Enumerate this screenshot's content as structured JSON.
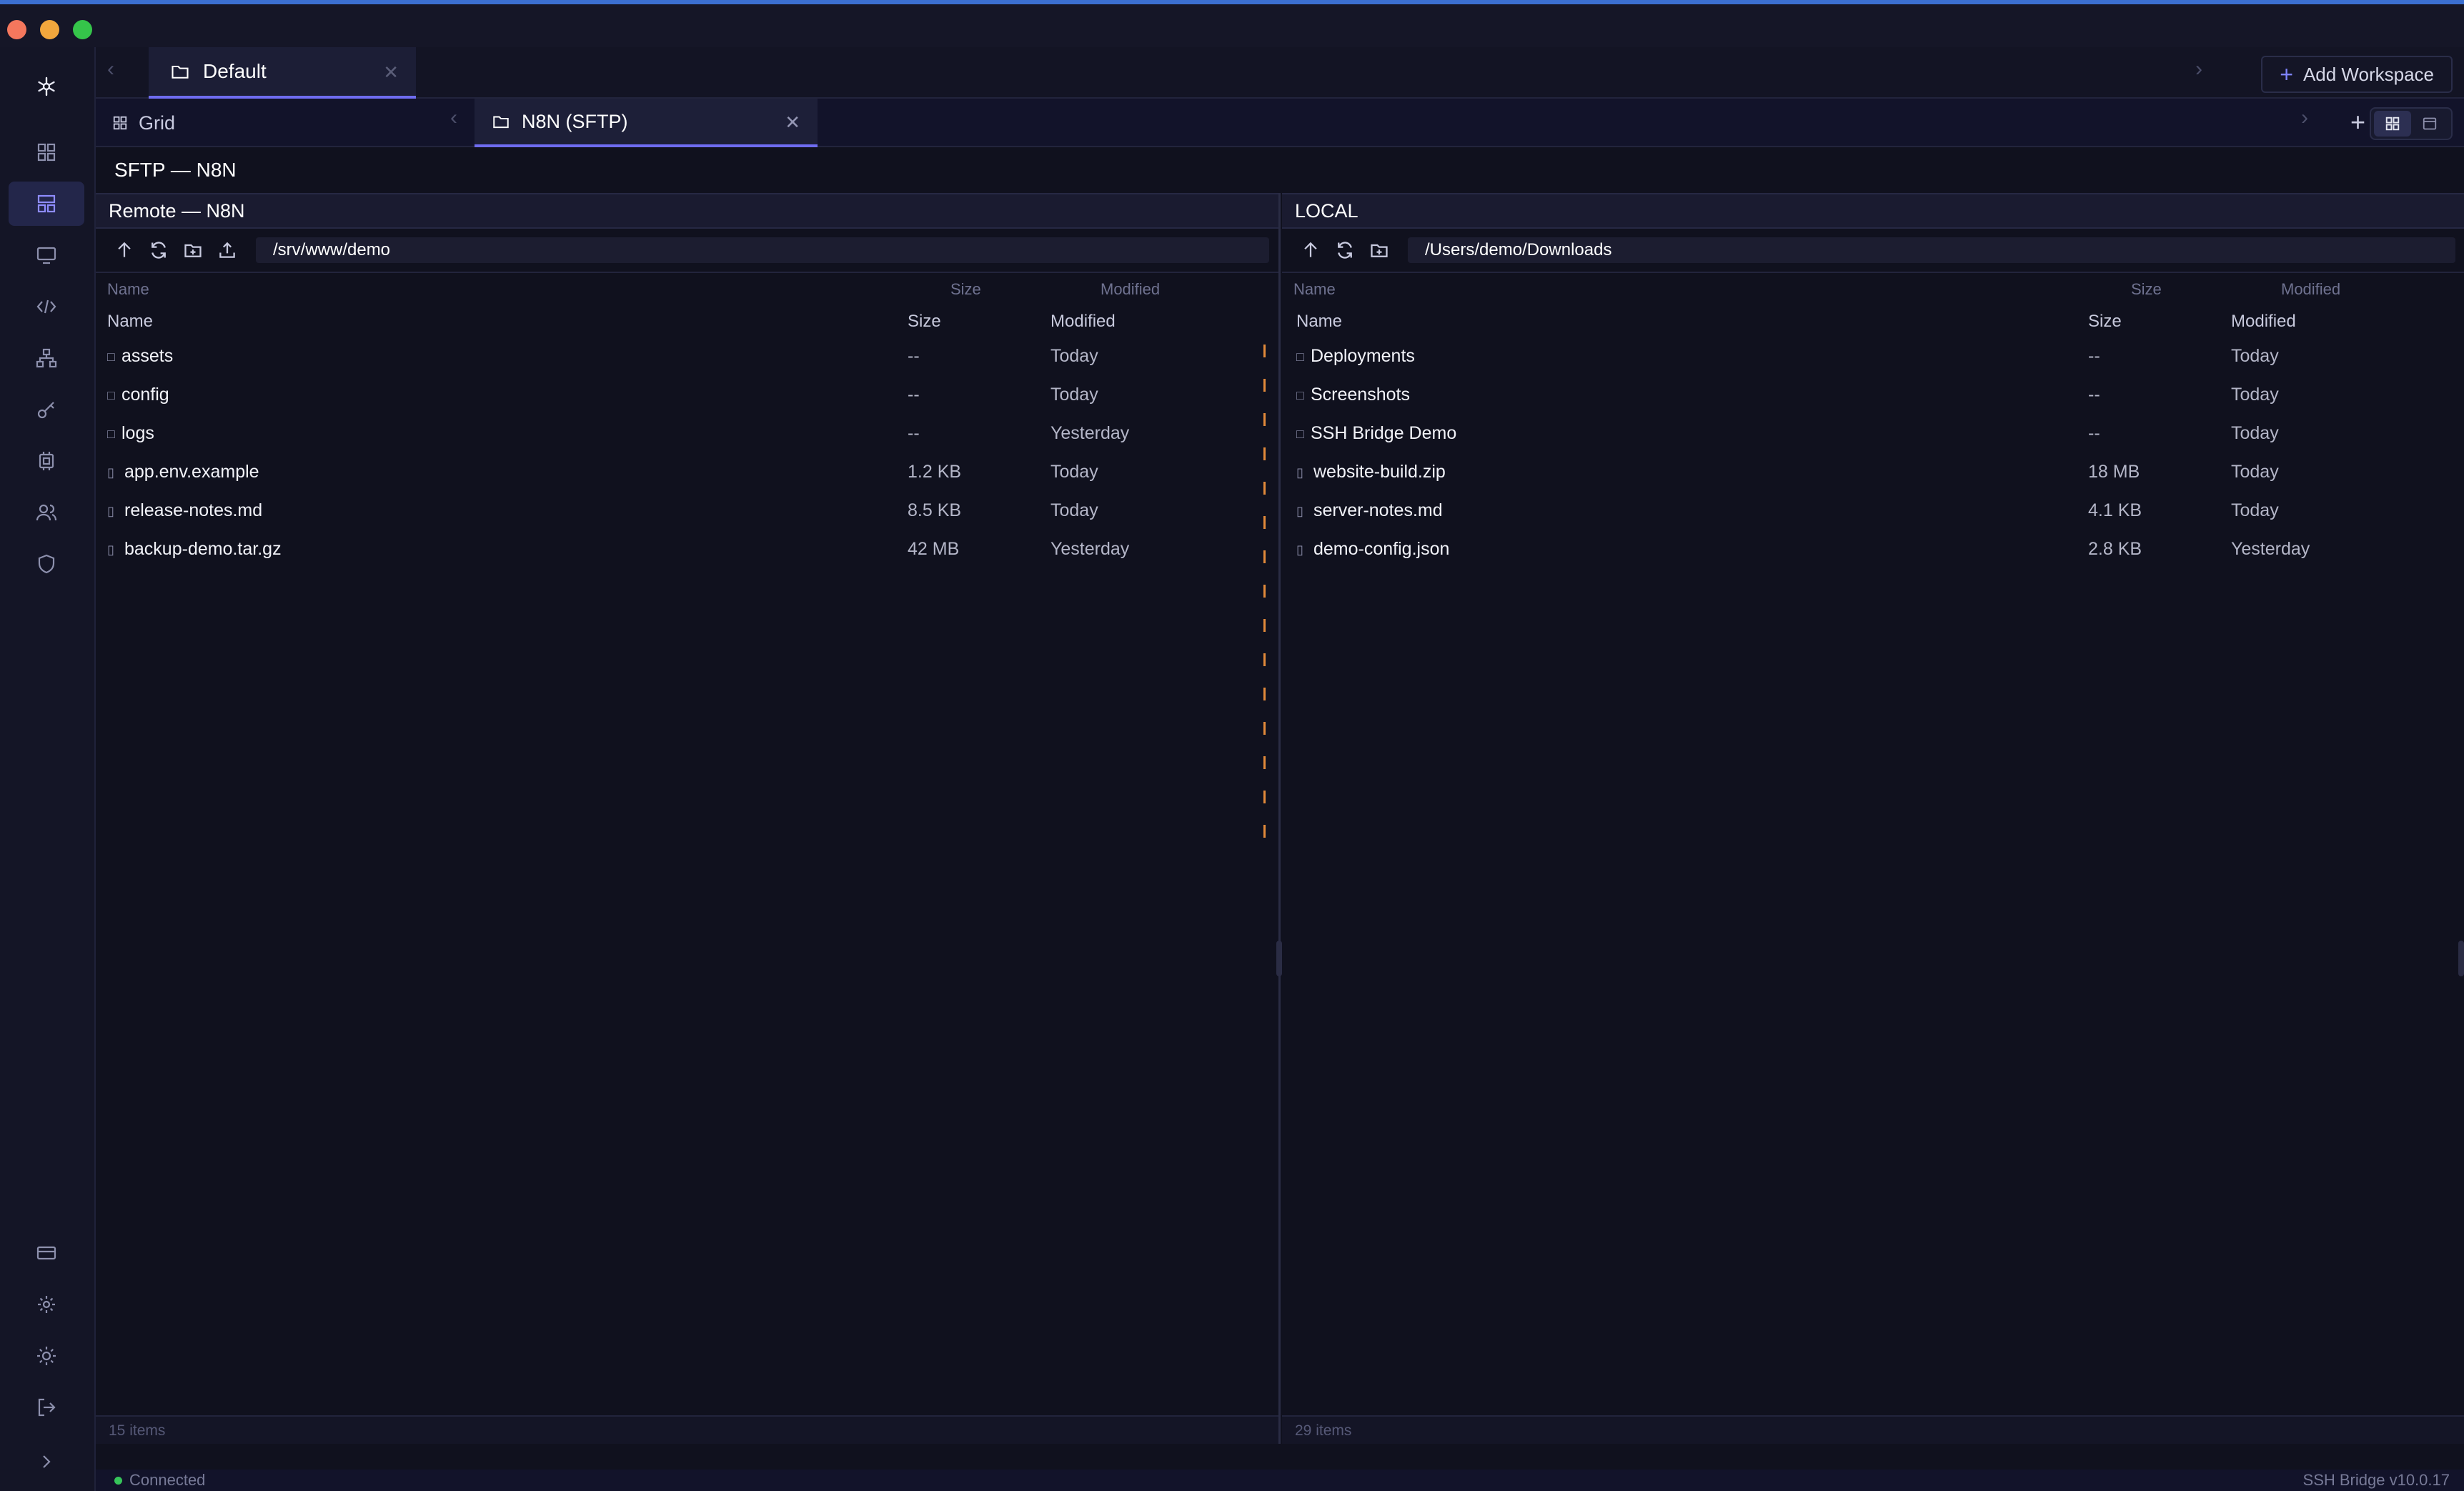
{
  "workspace_tabs": {
    "active": "Default",
    "add_label": "Add Workspace"
  },
  "sub_tabs": {
    "grid_label": "Grid",
    "active_label": "N8N (SFTP)"
  },
  "breadcrumb": "SFTP — N8N",
  "remote": {
    "title": "Remote — N8N",
    "path": "/srv/www/demo",
    "columns_dim": [
      "Name",
      "Size",
      "Modified"
    ],
    "columns": [
      "Name",
      "Size",
      "Modified"
    ],
    "rows": [
      {
        "name": "assets",
        "size": "--",
        "modified": "Today",
        "kind": "folder"
      },
      {
        "name": "config",
        "size": "--",
        "modified": "Today",
        "kind": "folder"
      },
      {
        "name": "logs",
        "size": "--",
        "modified": "Yesterday",
        "kind": "folder"
      },
      {
        "name": "app.env.example",
        "size": "1.2 KB",
        "modified": "Today",
        "kind": "file"
      },
      {
        "name": "release-notes.md",
        "size": "8.5 KB",
        "modified": "Today",
        "kind": "file"
      },
      {
        "name": "backup-demo.tar.gz",
        "size": "42 MB",
        "modified": "Yesterday",
        "kind": "file"
      }
    ],
    "item_count": "15 items"
  },
  "local": {
    "title": "LOCAL",
    "path": "/Users/demo/Downloads",
    "columns_dim": [
      "Name",
      "Size",
      "Modified"
    ],
    "columns": [
      "Name",
      "Size",
      "Modified"
    ],
    "rows": [
      {
        "name": "Deployments",
        "size": "--",
        "modified": "Today",
        "kind": "folder"
      },
      {
        "name": "Screenshots",
        "size": "--",
        "modified": "Today",
        "kind": "folder"
      },
      {
        "name": "SSH Bridge Demo",
        "size": "--",
        "modified": "Today",
        "kind": "folder"
      },
      {
        "name": "website-build.zip",
        "size": "18 MB",
        "modified": "Today",
        "kind": "file"
      },
      {
        "name": "server-notes.md",
        "size": "4.1 KB",
        "modified": "Today",
        "kind": "file"
      },
      {
        "name": "demo-config.json",
        "size": "2.8 KB",
        "modified": "Yesterday",
        "kind": "file"
      }
    ],
    "item_count": "29 items"
  },
  "status": {
    "connection": "Connected",
    "version": "SSH Bridge v10.0.17"
  },
  "colors": {
    "accent": "#6f6cf0",
    "connected": "#36c45a",
    "mark": "#e38a3a"
  }
}
